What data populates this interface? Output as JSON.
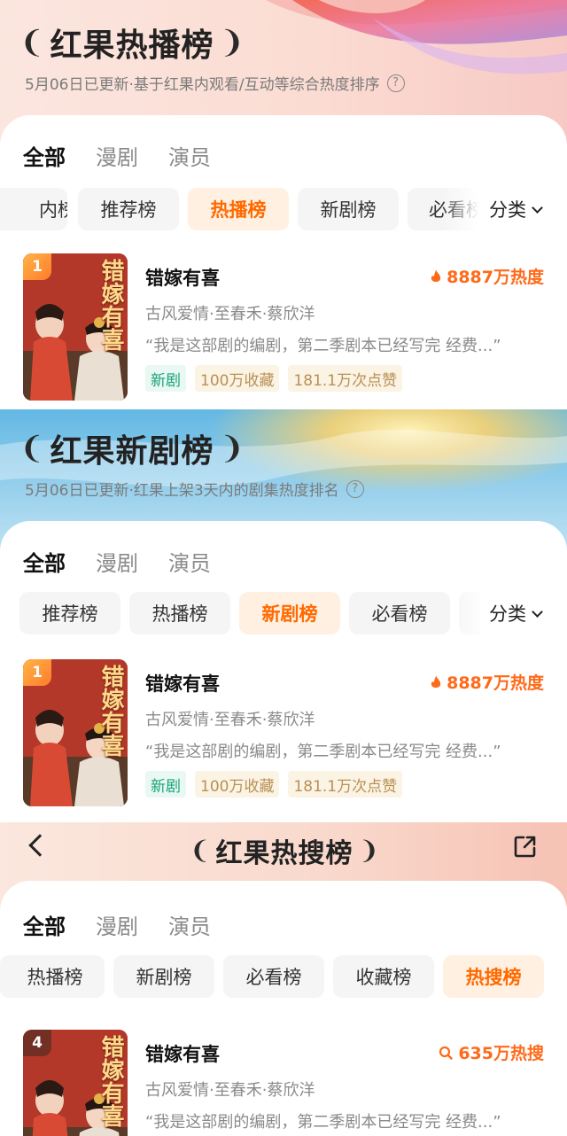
{
  "shows": {
    "title": "错嫁有喜",
    "meta": "古风爱情·至春禾·蔡欣洋",
    "quote": "“我是这部剧的编剧，第二季剧本已经写完  经费...”",
    "poster_text": "错嫁有喜",
    "tags": {
      "new": "新剧",
      "fav": "100万收藏",
      "likes": "181.1万次点赞"
    }
  },
  "common_tabs": [
    "全部",
    "漫剧",
    "演员"
  ],
  "category_label": "分类",
  "sec1": {
    "title": "红果热播榜",
    "subtitle": "5月06日已更新·基于红果内观看/互动等综合热度排序",
    "chips": [
      "内榜",
      "推荐榜",
      "热播榜",
      "新剧榜",
      "必看榜"
    ],
    "active_chip": "热播榜",
    "rank": "1",
    "heat": "8887万热度"
  },
  "sec2": {
    "title": "红果新剧榜",
    "subtitle": "5月06日已更新·红果上架3天内的剧集热度排名",
    "chips": [
      "推荐榜",
      "热播榜",
      "新剧榜",
      "必看榜"
    ],
    "active_chip": "新剧榜",
    "rank": "1",
    "heat": "8887万热度"
  },
  "sec3": {
    "title": "红果热搜榜",
    "chips": [
      "热播榜",
      "新剧榜",
      "必看榜",
      "收藏榜",
      "热搜榜"
    ],
    "active_chip": "热搜榜",
    "rank": "4",
    "heat": "635万热搜"
  },
  "colors": {
    "accent": "#ff6a00",
    "tag_green": "#19a37a",
    "tag_gold": "#b99055"
  },
  "icons": [
    "help-icon",
    "chevron-down-icon",
    "flame-icon",
    "search-icon",
    "back-icon",
    "share-icon",
    "laurel-left-icon",
    "laurel-right-icon"
  ]
}
